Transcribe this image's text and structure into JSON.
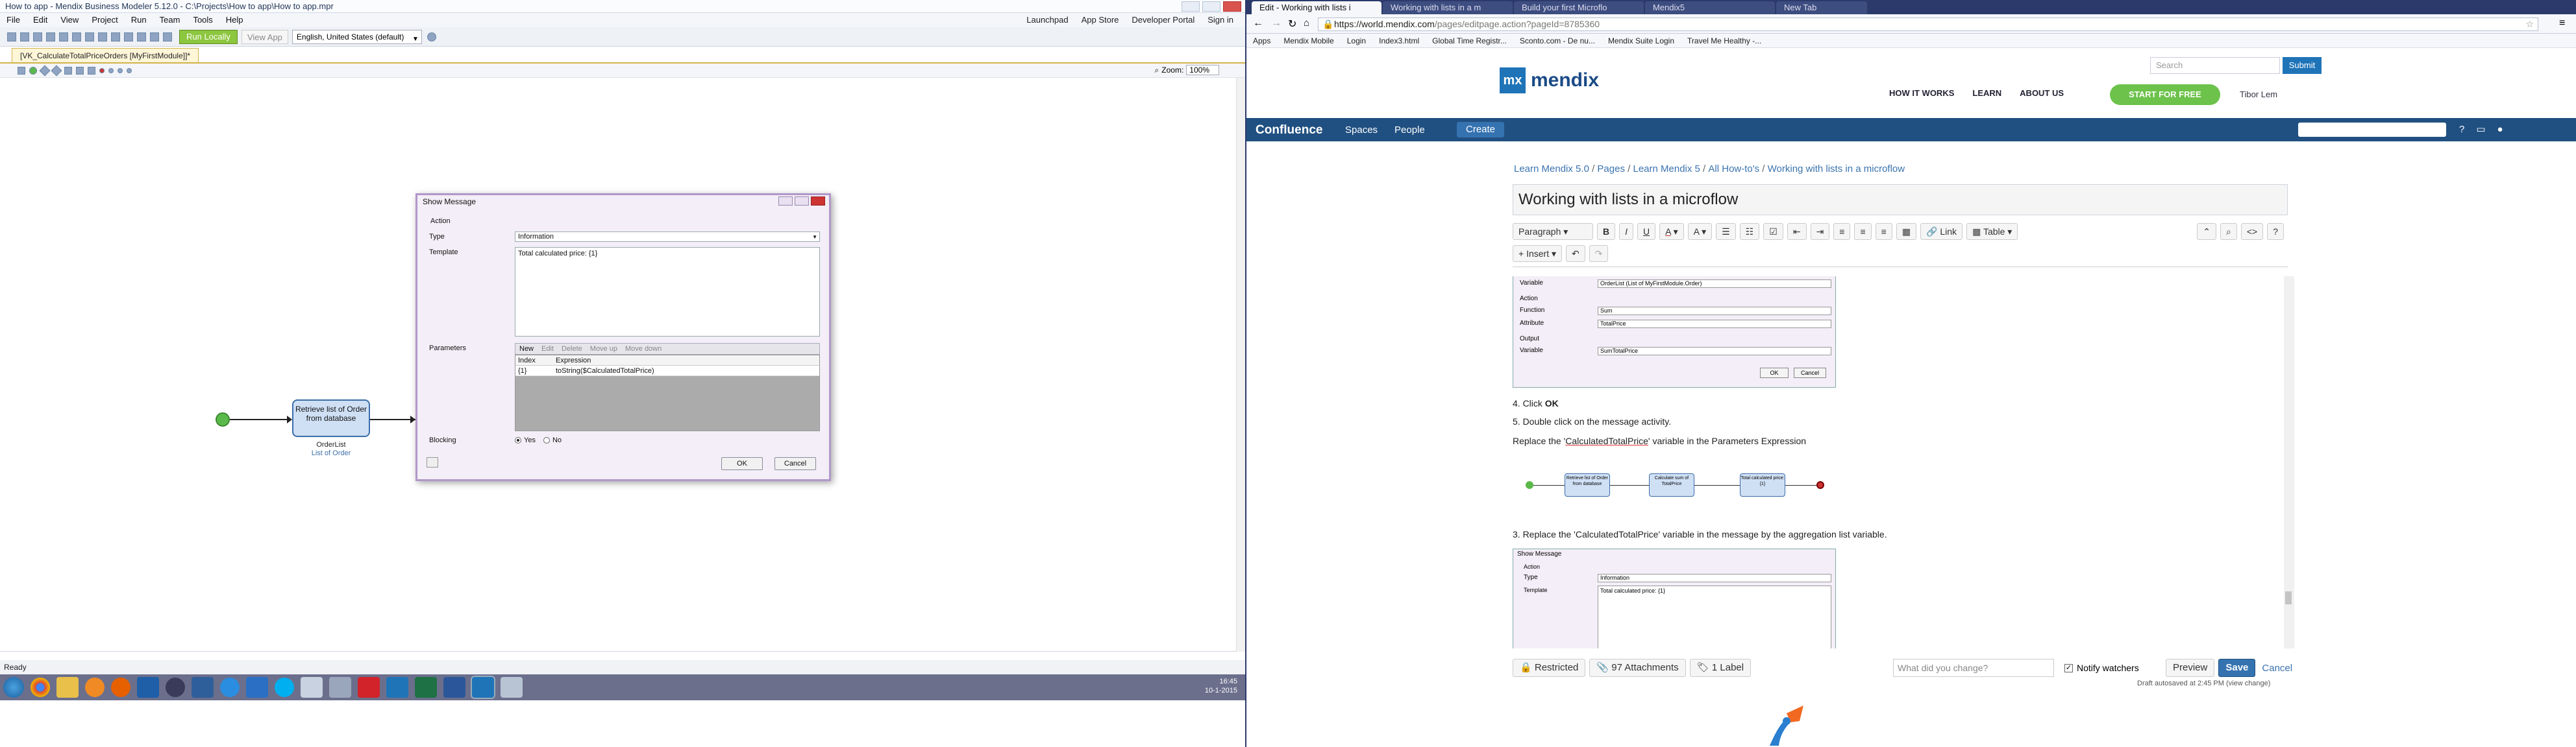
{
  "modeler": {
    "window_title": "How to app - Mendix Business Modeler 5.12.0 - C:\\Projects\\How to app\\How to app.mpr",
    "menu": [
      "File",
      "Edit",
      "View",
      "Project",
      "Run",
      "Team",
      "Tools",
      "Help"
    ],
    "menu_right": [
      "Launchpad",
      "App Store",
      "Developer Portal",
      "Sign in"
    ],
    "run_locally": "Run Locally",
    "view_app": "View App",
    "language": "English, United States (default)",
    "doc_tab": "[VK_CalculateTotalPriceOrders [MyFirstModule]]*",
    "zoom_label": "Zoom:",
    "zoom_value": "100%",
    "activity": {
      "label": "Retrieve list of Order from database",
      "output_name": "OrderList",
      "output_type": "List of Order"
    },
    "status": "Ready"
  },
  "dialog": {
    "title": "Show Message",
    "section_action": "Action",
    "type_label": "Type",
    "type_value": "Information",
    "template_label": "Template",
    "template_value": "Total calculated price: {1}",
    "parameters_label": "Parameters",
    "param_toolbar": [
      "New",
      "Edit",
      "Delete",
      "Move up",
      "Move down"
    ],
    "param_headers": [
      "Index",
      "Expression"
    ],
    "param_rows": [
      {
        "index": "{1}",
        "expression": "toString($CalculatedTotalPrice)"
      }
    ],
    "blocking_label": "Blocking",
    "blocking_yes": "Yes",
    "blocking_no": "No",
    "ok": "OK",
    "cancel": "Cancel"
  },
  "taskbar": {
    "clock_time": "16:45",
    "clock_date": "10-1-2015"
  },
  "browser": {
    "tabs": [
      "Edit - Working with lists i",
      "Working with lists in a m",
      "Build your first Microflo",
      "Mendix5",
      "New Tab"
    ],
    "url_host": "https://world.mendix.com",
    "url_rest": "/pages/editpage.action?pageId=8785360",
    "bookmarks": [
      "Apps",
      "Mendix Mobile",
      "Login",
      "Index3.html",
      "Global Time Registr...",
      "Sconto.com - De nu...",
      "Mendix Suite Login",
      "Travel Me Healthy -..."
    ]
  },
  "mendix_site": {
    "logo_mark": "mx",
    "logo_word": "mendix",
    "search_placeholder": "Search",
    "submit": "Submit",
    "nav": [
      "HOW IT WORKS",
      "LEARN",
      "ABOUT US"
    ],
    "start_free": "START FOR FREE",
    "user": "Tibor Lem"
  },
  "confluence": {
    "logo": "Confluence",
    "nav": [
      "Spaces",
      "People"
    ],
    "create": "Create",
    "breadcrumbs": [
      "Learn Mendix 5.0",
      "Pages",
      "Learn Mendix 5",
      "All How-to's",
      "Working with lists in a microflow"
    ],
    "page_title": "Working with lists in a microflow",
    "toolbar": {
      "paragraph": "Paragraph",
      "bold": "B",
      "italic": "I",
      "underline": "U",
      "color": "A",
      "size": "A",
      "link": "Link",
      "table": "Table",
      "insert": "Insert"
    },
    "content": {
      "shot1_rows": [
        {
          "label": "Variable",
          "value": "OrderList (List of MyFirstModule.Order)"
        },
        {
          "label": "Action",
          "value": ""
        },
        {
          "label": "Function",
          "value": "Sum"
        },
        {
          "label": "Attribute",
          "value": "TotalPrice"
        },
        {
          "label": "Output",
          "value": ""
        },
        {
          "label": "Variable",
          "value": "SumTotalPrice"
        }
      ],
      "shot1_ok": "OK",
      "shot1_cancel": "Cancel",
      "step4": "4. Click ",
      "step4_bold": "OK",
      "step5": "5. Double click on the message activity.",
      "replace_pre": "Replace the '",
      "replace_var": "CalculatedTotalPrice",
      "replace_post": "' variable in the Parameters Expression",
      "flow_nodes": [
        "Retrieve list of Order from database",
        "Calculate sum of TotalPrice",
        "Total calculated price: {1}"
      ],
      "step3": "3. Replace the 'CalculatedTotalPrice' variable in the message by the aggregation list variable.",
      "shot2_title": "Show Message",
      "shot2_action": "Action",
      "shot2_type": "Type",
      "shot2_type_value": "Information",
      "shot2_template": "Template",
      "shot2_template_value": "Total calculated price: {1}"
    },
    "bottom": {
      "restricted": "Restricted",
      "attachments": "97 Attachments",
      "labels": "1 Label",
      "what_changed": "What did you change?",
      "notify": "Notify watchers",
      "preview": "Preview",
      "save": "Save",
      "cancel": "Cancel",
      "autosave": "Draft autosaved at 2:45 PM (view change)"
    }
  },
  "colors": {
    "confluence_nav": "#205081",
    "mendix_blue": "#1f74b8",
    "start_free_green": "#6cc24a",
    "run_green": "#8dc63f"
  }
}
